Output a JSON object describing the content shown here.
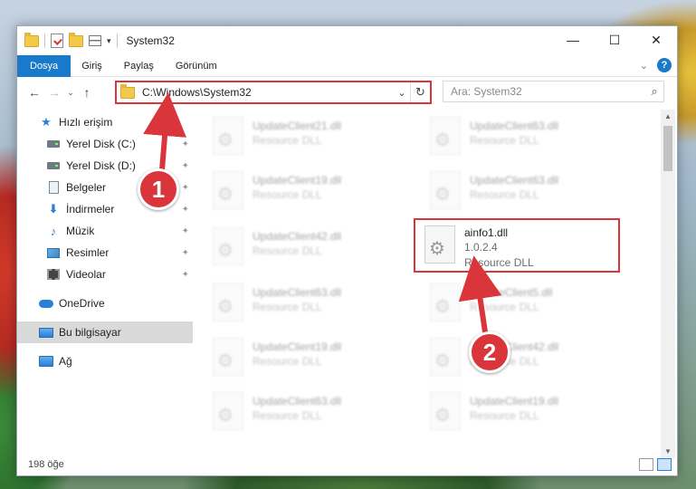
{
  "window": {
    "title": "System32",
    "controls": {
      "minimize": "—",
      "maximize": "☐",
      "close": "✕"
    }
  },
  "quick_access_toolbar": {
    "dropdown": "▾"
  },
  "ribbon": {
    "tabs": [
      {
        "label": "Dosya",
        "active": true
      },
      {
        "label": "Giriş",
        "active": false
      },
      {
        "label": "Paylaş",
        "active": false
      },
      {
        "label": "Görünüm",
        "active": false
      }
    ],
    "collapse": "⌄",
    "help": "?"
  },
  "navbar": {
    "back": "←",
    "forward": "→",
    "recent": "⌄",
    "up": "↑",
    "address": "C:\\Windows\\System32",
    "address_dropdown": "⌄",
    "refresh": "↻",
    "search_placeholder": "Ara: System32",
    "search_icon": "⌕"
  },
  "sidebar": {
    "quick_access": {
      "label": "Hızlı erişim"
    },
    "items": [
      {
        "label": "Yerel Disk (C:)",
        "icon": "drive-icon",
        "pinned": true
      },
      {
        "label": "Yerel Disk (D:)",
        "icon": "drive-icon",
        "pinned": true
      },
      {
        "label": "Belgeler",
        "icon": "documents-icon",
        "pinned": true
      },
      {
        "label": "İndirmeler",
        "icon": "downloads-icon",
        "pinned": true
      },
      {
        "label": "Müzik",
        "icon": "music-icon",
        "pinned": true
      },
      {
        "label": "Resimler",
        "icon": "pictures-icon",
        "pinned": true
      },
      {
        "label": "Videolar",
        "icon": "videos-icon",
        "pinned": true
      }
    ],
    "onedrive": {
      "label": "OneDrive"
    },
    "this_pc": {
      "label": "Bu bilgisayar",
      "selected": true
    },
    "network": {
      "label": "Ağ"
    },
    "pin_glyph": "📌"
  },
  "files": [
    {
      "name": "UpdateClient21.dll",
      "sub": "Resource DLL",
      "col": 0,
      "row": 0,
      "blurred": true
    },
    {
      "name": "UpdateClient63.dll",
      "sub": "Resource DLL",
      "col": 1,
      "row": 0,
      "blurred": true
    },
    {
      "name": "UpdateClient19.dll",
      "sub": "Resource DLL",
      "col": 0,
      "row": 1,
      "blurred": true
    },
    {
      "name": "UpdateClient63.dll",
      "sub": "Resource DLL",
      "col": 1,
      "row": 1,
      "blurred": true
    },
    {
      "name": "UpdateClient42.dll",
      "sub": "Resource DLL",
      "col": 0,
      "row": 2,
      "blurred": true
    },
    {
      "name": "ainfo1.dll",
      "version": "1.0.2.4",
      "sub": "Resource DLL",
      "col": 1,
      "row": 2,
      "blurred": false,
      "highlighted": true
    },
    {
      "name": "UpdateClient63.dll",
      "sub": "Resource DLL",
      "col": 0,
      "row": 3,
      "blurred": true
    },
    {
      "name": "UpdateClient5.dll",
      "sub": "Resource DLL",
      "col": 1,
      "row": 3,
      "blurred": true
    },
    {
      "name": "UpdateClient19.dll",
      "sub": "Resource DLL",
      "col": 0,
      "row": 4,
      "blurred": true
    },
    {
      "name": "UpdateClient42.dll",
      "sub": "Resource DLL",
      "col": 1,
      "row": 4,
      "blurred": true
    },
    {
      "name": "UpdateClient63.dll",
      "sub": "Resource DLL",
      "col": 0,
      "row": 5,
      "blurred": true
    },
    {
      "name": "UpdateClient19.dll",
      "sub": "Resource DLL",
      "col": 1,
      "row": 5,
      "blurred": true
    }
  ],
  "scrollbar": {
    "up": "▲",
    "down": "▼"
  },
  "status": {
    "count_text": "198 öğe"
  },
  "annotations": {
    "callout_1": "1",
    "callout_2": "2",
    "accent_color": "#d9353b"
  }
}
